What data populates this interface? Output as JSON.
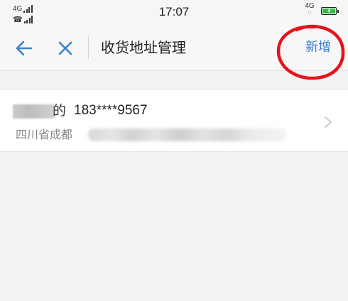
{
  "status_bar": {
    "network_top": "4G",
    "network_bottom": "☎",
    "time": "17:07",
    "data_type": "4G",
    "data_arrows": "↑↓"
  },
  "nav": {
    "back_icon": "arrow-left-icon",
    "close_icon": "close-icon",
    "title": "收货地址管理",
    "add_label": "新增"
  },
  "address": {
    "name_tail": "的",
    "phone": "183****9567",
    "address_prefix": "四川省成都"
  },
  "colors": {
    "accent": "#3a7fd5",
    "annotation": "#e8111a",
    "battery": "#35b54a"
  }
}
